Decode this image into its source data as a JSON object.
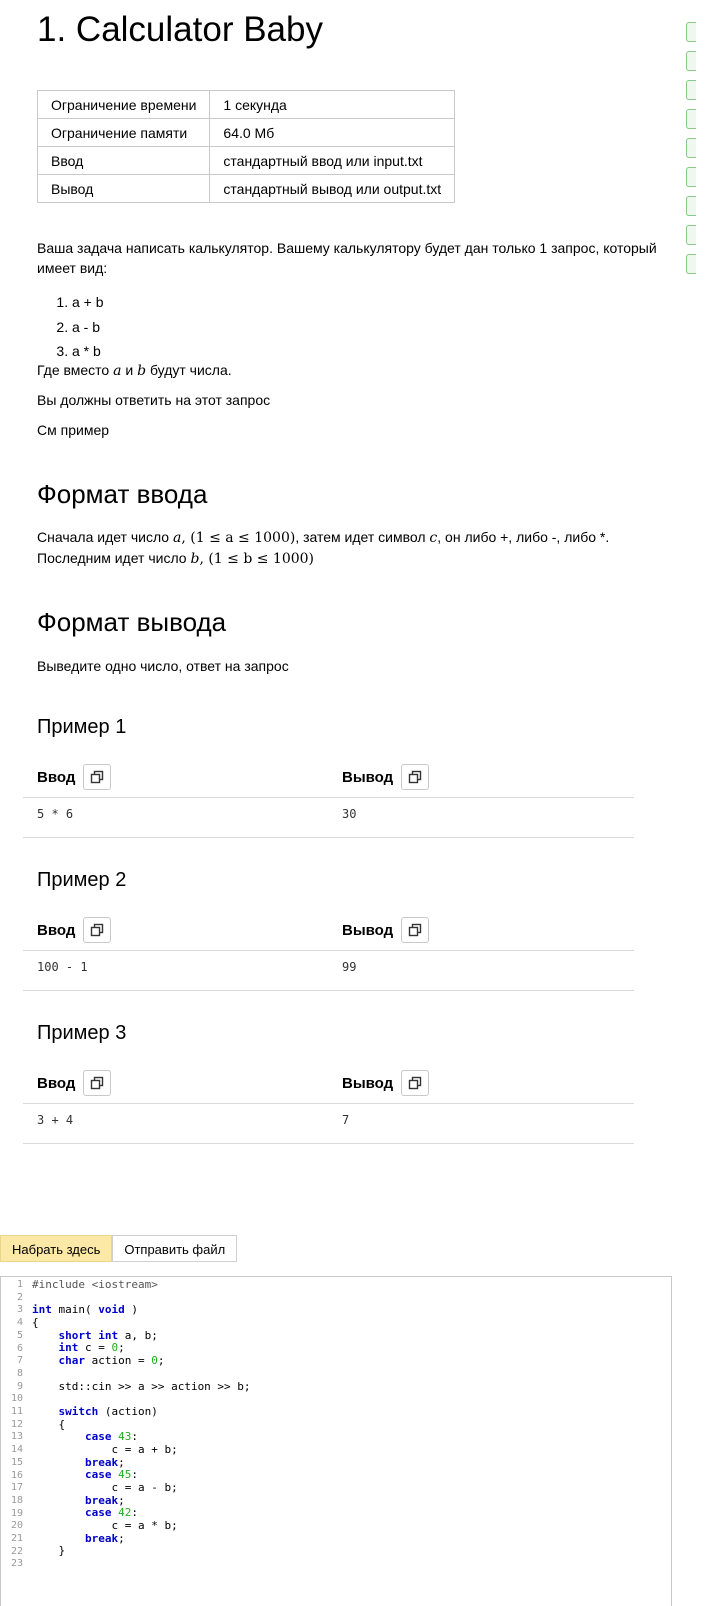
{
  "problem": {
    "title": "1. Calculator Baby",
    "limits": [
      {
        "key": "Ограничение времени",
        "value": "1 секунда"
      },
      {
        "key": "Ограничение памяти",
        "value": "64.0 Мб"
      },
      {
        "key": "Ввод",
        "value": "стандартный ввод или input.txt"
      },
      {
        "key": "Вывод",
        "value": "стандартный вывод или output.txt"
      }
    ],
    "statement_intro": "Ваша задача написать калькулятор. Вашему калькулятору будет дан только 1 запрос, который имеет вид:",
    "operations": [
      "a + b",
      "a - b",
      "a * b"
    ],
    "where": {
      "pre": "Где вместо ",
      "a": "a",
      "mid": " и ",
      "b": "b",
      "post": " будут числа."
    },
    "answer_line": "Вы должны ответить на этот запрос",
    "see_example": "См пример",
    "input_format": {
      "heading": "Формат ввода",
      "p1": "Сначала идет число ",
      "var_a": "a",
      "cons_a": ", (1 ≤ a ≤ 1000)",
      "p2": ", затем идет символ ",
      "var_c": "c",
      "p3": ", он либо +, либо -, либо *.",
      "p4": "Последним идет число ",
      "var_b": "b",
      "cons_b": ", (1 ≤ b ≤ 1000)"
    },
    "output_format": {
      "heading": "Формат вывода",
      "text": "Выведите одно число, ответ на запрос"
    },
    "examples": [
      {
        "heading": "Пример 1",
        "input_label": "Ввод",
        "output_label": "Вывод",
        "input": "5 * 6",
        "output": "30"
      },
      {
        "heading": "Пример 2",
        "input_label": "Ввод",
        "output_label": "Вывод",
        "input": "100 - 1",
        "output": "99"
      },
      {
        "heading": "Пример 3",
        "input_label": "Ввод",
        "output_label": "Вывод",
        "input": "3 + 4",
        "output": "7"
      }
    ]
  },
  "submit": {
    "tab_type_here": "Набрать здесь",
    "tab_send_file": "Отправить файл"
  },
  "editor": {
    "line_numbers": [
      "1",
      "2",
      "3",
      "4",
      "5",
      "6",
      "7",
      "8",
      "9",
      "10",
      "11",
      "12",
      "13",
      "14",
      "15",
      "16",
      "17",
      "18",
      "19",
      "20",
      "21",
      "22",
      "23"
    ],
    "code_lines": [
      "#include <iostream>",
      "",
      "int main( void )",
      "{",
      "    short int a, b;",
      "    int c = 0;",
      "    char action = 0;",
      "",
      "    std::cin >> a >> action >> b;",
      "",
      "    switch (action)",
      "    {",
      "        case 43:",
      "            c = a + b;",
      "        break;",
      "        case 45:",
      "            c = a - b;",
      "        break;",
      "        case 42:",
      "            c = a * b;",
      "        break;",
      "    }",
      ""
    ]
  },
  "icons": {
    "copy": "copy-icon"
  },
  "colors": {
    "active_tab": "#fce8a7",
    "keyword": "#0000cc",
    "number": "#22aa22",
    "marker": "#8ac88a"
  }
}
